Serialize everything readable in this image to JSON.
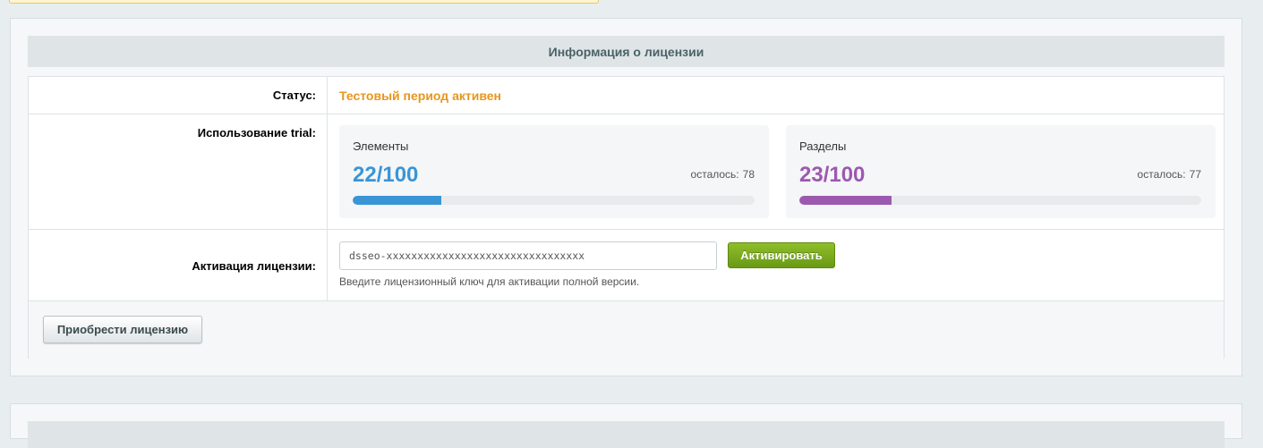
{
  "license": {
    "header": "Информация о лицензии",
    "status": {
      "label": "Статус:",
      "value": "Тестовый период активен",
      "color": "#e8961c"
    },
    "trial": {
      "label": "Использование trial:",
      "elements": {
        "title": "Элементы",
        "count": "22/100",
        "remaining_label": "осталось:",
        "remaining": "78",
        "progress": 0.22,
        "color": "#3a95d6"
      },
      "sections": {
        "title": "Разделы",
        "count": "23/100",
        "remaining_label": "осталось:",
        "remaining": "77",
        "progress": 0.23,
        "color": "#9c59b0"
      }
    },
    "activation": {
      "label": "Активация лицензии:",
      "input_value": "dsseo-xxxxxxxxxxxxxxxxxxxxxxxxxxxxxxxx",
      "button_label": "Активировать",
      "hint": "Введите лицензионный ключ для активации полной версии.",
      "button_color": "#7aab1e"
    },
    "buy_button_label": "Приобрести лицензию"
  }
}
